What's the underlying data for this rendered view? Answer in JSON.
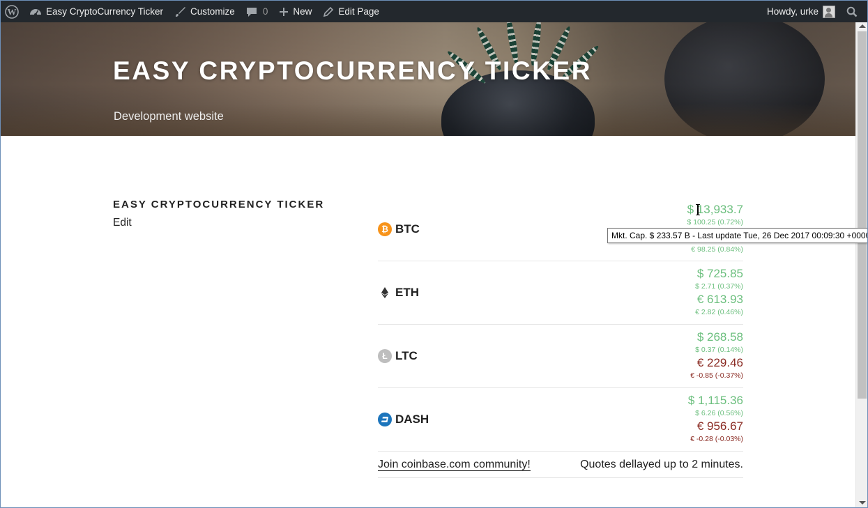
{
  "adminbar": {
    "site_name": "Easy CryptoCurrency Ticker",
    "customize": "Customize",
    "comments_count": "0",
    "new_label": "New",
    "edit_page": "Edit Page",
    "howdy": "Howdy, urke"
  },
  "header": {
    "site_title": "EASY CRYPTOCURRENCY TICKER",
    "description": "Development website"
  },
  "page": {
    "entry_title": "EASY CRYPTOCURRENCY TICKER",
    "edit_label": "Edit"
  },
  "ticker": {
    "coins": [
      {
        "symbol": "BTC",
        "icon": "bitcoin-icon",
        "color": "#f7931a",
        "usd": "$ 13,933.7",
        "usd_change": "$ 100.25 (0.72%)",
        "usd_trend": "up",
        "eur_change": "€ 98.25 (0.84%)",
        "eur_trend": "up"
      },
      {
        "symbol": "ETH",
        "icon": "ethereum-icon",
        "color": "#222222",
        "usd": "$ 725.85",
        "usd_change": "$ 2.71 (0.37%)",
        "usd_trend": "up",
        "eur": "€ 613.93",
        "eur_change": "€ 2.82 (0.46%)",
        "eur_trend": "up"
      },
      {
        "symbol": "LTC",
        "icon": "litecoin-icon",
        "color": "#bebebe",
        "usd": "$ 268.58",
        "usd_change": "$ 0.37 (0.14%)",
        "usd_trend": "up",
        "eur": "€ 229.46",
        "eur_change": "€ -0.85 (-0.37%)",
        "eur_trend": "down"
      },
      {
        "symbol": "DASH",
        "icon": "dash-icon",
        "color": "#1c75bc",
        "usd": "$ 1,115.36",
        "usd_change": "$ 6.26 (0.56%)",
        "usd_trend": "up",
        "eur": "€ 956.67",
        "eur_change": "€ -0.28 (-0.03%)",
        "eur_trend": "down"
      }
    ],
    "join_link": "Join coinbase.com community!",
    "delay_note": "Quotes dellayed up to 2 minutes."
  },
  "tooltip": "Mkt. Cap. $ 233.57 B - Last update Tue, 26 Dec 2017 00:09:30 +0000",
  "colors": {
    "up": "#6cbf7e",
    "down": "#8a2a22",
    "adminbar": "#23282d"
  }
}
